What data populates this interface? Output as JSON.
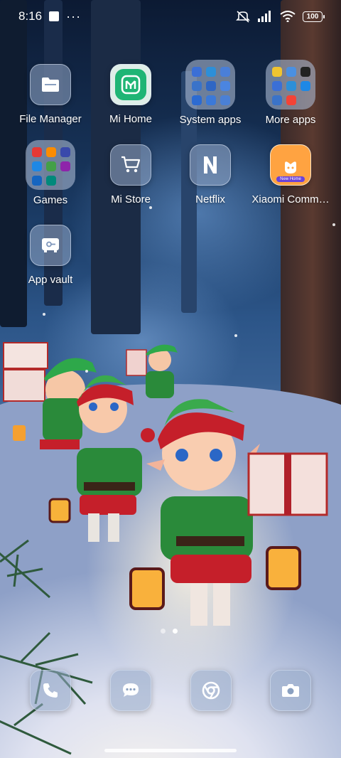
{
  "status_bar": {
    "time": "8:16",
    "battery": "100",
    "icons": [
      "square-notification-icon",
      "more-dots-icon",
      "mute-vibrate-icon",
      "signal-icon",
      "wifi-icon",
      "battery-icon"
    ]
  },
  "apps": [
    {
      "label": "File Manager",
      "icon": "folder-icon"
    },
    {
      "label": "Mi Home",
      "icon": "mi-home-icon"
    },
    {
      "label": "System apps",
      "icon": "folder-grid-icon"
    },
    {
      "label": "More apps",
      "icon": "folder-grid-icon"
    },
    {
      "label": "Games",
      "icon": "folder-grid-icon"
    },
    {
      "label": "Mi Store",
      "icon": "cart-icon"
    },
    {
      "label": "Netflix",
      "icon": "netflix-icon"
    },
    {
      "label": "Xiaomi Comm…",
      "icon": "xiaomi-community-icon",
      "badge_text": "New Home"
    },
    {
      "label": "App vault",
      "icon": "vault-icon"
    }
  ],
  "dock": [
    {
      "name": "phone",
      "icon": "phone-icon"
    },
    {
      "name": "messages",
      "icon": "chat-icon"
    },
    {
      "name": "browser",
      "icon": "chrome-icon"
    },
    {
      "name": "camera",
      "icon": "camera-icon"
    }
  ],
  "pages": {
    "count": 2,
    "active": 1
  },
  "colors": {
    "mi_home_green": "#1fb575",
    "tile_glass": "#96aac8",
    "xiaomi_comm_bg": "#ffa341"
  }
}
